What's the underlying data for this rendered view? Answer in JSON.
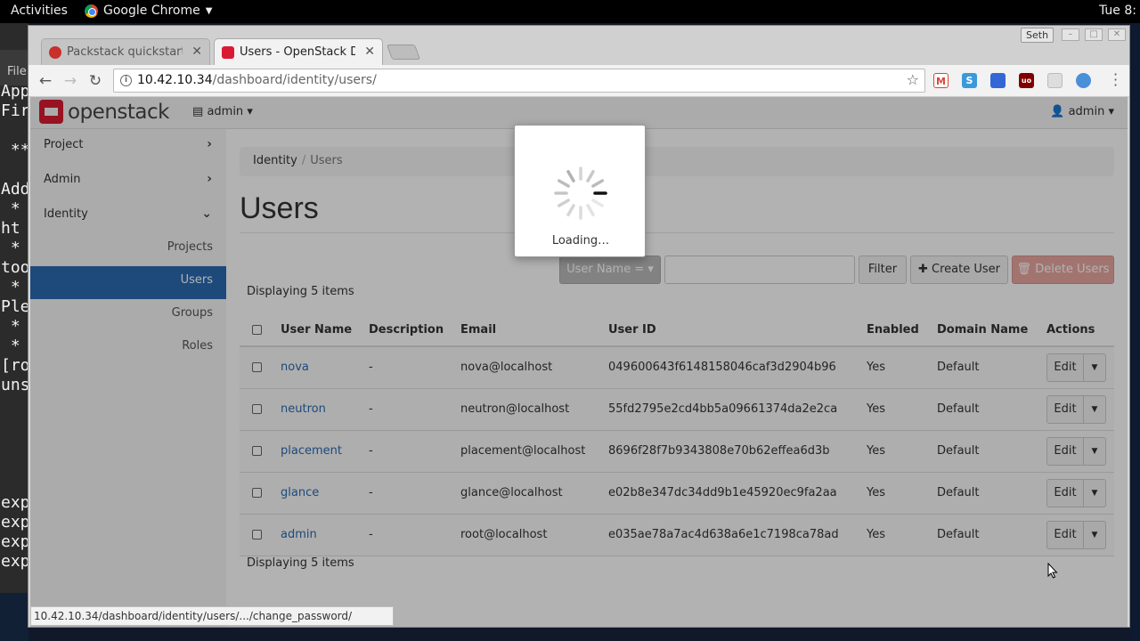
{
  "system_bar": {
    "activities": "Activities",
    "app_name": "Google Chrome",
    "clock": "Tue 8:"
  },
  "terminal": {
    "menu": "File",
    "lines": [
      "App",
      "Fir",
      "",
      " **",
      "",
      "Add",
      " *",
      "ht",
      " *",
      "too",
      " *",
      "Ple",
      " *",
      " *",
      "[ro",
      "uns",
      "",
      "",
      "",
      "",
      "",
      "exp",
      "exp",
      "exp",
      "exp"
    ]
  },
  "browser": {
    "tabs": [
      {
        "title": "Packstack quickstart -",
        "favicon_color": "#c9302c"
      },
      {
        "title": "Users - OpenStack Das",
        "favicon_color": "#da1a32"
      }
    ],
    "profile_name": "Seth",
    "url_host": "10.42.10.34",
    "url_path": "/dashboard/identity/users/",
    "extensions": [
      {
        "name": "gmail-icon",
        "color": "#db4437",
        "glyph": "M"
      },
      {
        "name": "skype-icon",
        "color": "#3a9ad9",
        "glyph": "S"
      },
      {
        "name": "calendar-icon",
        "color": "#3367d6",
        "glyph": ""
      },
      {
        "name": "ublock-icon",
        "color": "#800000",
        "glyph": "uo"
      },
      {
        "name": "reader-icon",
        "color": "#bbbbbb",
        "glyph": ""
      },
      {
        "name": "globe-icon",
        "color": "#4a90d9",
        "glyph": ""
      }
    ],
    "status_url": "10.42.10.34/dashboard/identity/users/.../change_password/"
  },
  "openstack": {
    "brand": "openstack",
    "project_menu": "admin",
    "user_menu": "admin",
    "sidebar": {
      "sections": [
        {
          "label": "Project",
          "chevron": "›"
        },
        {
          "label": "Admin",
          "chevron": "›"
        },
        {
          "label": "Identity",
          "chevron": "⌄"
        }
      ],
      "identity_items": [
        {
          "label": "Projects",
          "active": false
        },
        {
          "label": "Users",
          "active": true
        },
        {
          "label": "Groups",
          "active": false
        },
        {
          "label": "Roles",
          "active": false
        }
      ]
    },
    "breadcrumb": {
      "root": "Identity",
      "separator": "/",
      "current": "Users"
    },
    "page_title": "Users",
    "filter": {
      "field_label": "User Name =",
      "filter_button": "Filter",
      "create_button": "Create User",
      "delete_button": "Delete Users"
    },
    "count_label": "Displaying 5 items",
    "table": {
      "columns": [
        "User Name",
        "Description",
        "Email",
        "User ID",
        "Enabled",
        "Domain Name",
        "Actions"
      ],
      "rows": [
        {
          "name": "nova",
          "description": "-",
          "email": "nova@localhost",
          "id": "049600643f6148158046caf3d2904b96",
          "enabled": "Yes",
          "domain": "Default"
        },
        {
          "name": "neutron",
          "description": "-",
          "email": "neutron@localhost",
          "id": "55fd2795e2cd4bb5a09661374da2e2ca",
          "enabled": "Yes",
          "domain": "Default"
        },
        {
          "name": "placement",
          "description": "-",
          "email": "placement@localhost",
          "id": "8696f28f7b9343808e70b62effea6d3b",
          "enabled": "Yes",
          "domain": "Default"
        },
        {
          "name": "glance",
          "description": "-",
          "email": "glance@localhost",
          "id": "e02b8e347dc34dd9b1e45920ec9fa2aa",
          "enabled": "Yes",
          "domain": "Default"
        },
        {
          "name": "admin",
          "description": "-",
          "email": "root@localhost",
          "id": "e035ae78a7ac4d638a6e1c7198ca78ad",
          "enabled": "Yes",
          "domain": "Default"
        }
      ],
      "edit_label": "Edit"
    },
    "loading_text": "Loading…"
  },
  "colors": {
    "accent": "#2a6bb1",
    "brand_red": "#da1a32",
    "danger": "#e8a7a1"
  }
}
